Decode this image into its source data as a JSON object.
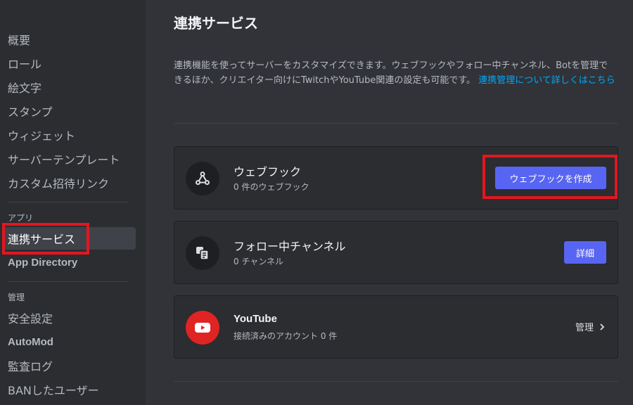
{
  "sidebar": {
    "items_top": [
      {
        "label": "概要"
      },
      {
        "label": "ロール"
      },
      {
        "label": "絵文字"
      },
      {
        "label": "スタンプ"
      },
      {
        "label": "ウィジェット"
      },
      {
        "label": "サーバーテンプレート"
      },
      {
        "label": "カスタム招待リンク"
      }
    ],
    "apps_header": "アプリ",
    "apps_items": [
      {
        "label": "連携サービス",
        "selected": true
      },
      {
        "label": "App Directory"
      }
    ],
    "mod_header": "管理",
    "mod_items": [
      {
        "label": "安全設定"
      },
      {
        "label": "AutoMod"
      },
      {
        "label": "監査ログ"
      },
      {
        "label": "BANしたユーザー"
      }
    ]
  },
  "main": {
    "title": "連携サービス",
    "description": "連携機能を使ってサーバーをカスタマイズできます。ウェブフックやフォロー中チャンネル、Botを管理できるほか、クリエイター向けにTwitchやYouTube関連の設定も可能です。",
    "description_link": "連携管理について詳しくはこちら",
    "cards": {
      "webhook": {
        "title": "ウェブフック",
        "subtitle": "0 件のウェブフック",
        "button": "ウェブフックを作成",
        "icon": "webhook-icon"
      },
      "following": {
        "title": "フォロー中チャンネル",
        "subtitle": "0 チャンネル",
        "button": "詳細",
        "icon": "channel-follow-icon"
      },
      "youtube": {
        "title": "YouTube",
        "subtitle": "接続済みのアカウント 0 件",
        "action": "管理",
        "icon": "youtube-icon"
      }
    }
  },
  "colors": {
    "accent": "#5865f2",
    "link": "#00a8fc",
    "highlight": "#e4161e",
    "youtube": "#e02423"
  }
}
